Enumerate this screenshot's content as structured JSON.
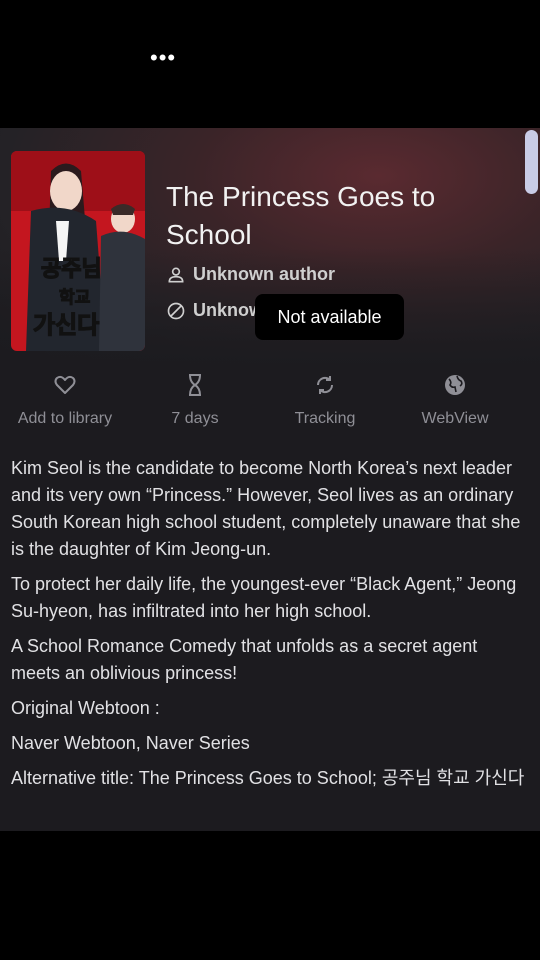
{
  "status_bar": {
    "overflow_icon": "more-dots-icon"
  },
  "manga": {
    "title": "The Princess Goes to School",
    "author": "Unknown author",
    "status": "Unknown",
    "cover_text": "공주님 학교 가신다"
  },
  "toast": {
    "text": "Not available"
  },
  "actions": [
    {
      "label": "Add to library",
      "icon": "heart-icon"
    },
    {
      "label": "7 days",
      "icon": "hourglass-icon"
    },
    {
      "label": "Tracking",
      "icon": "sync-icon"
    },
    {
      "label": "WebView",
      "icon": "globe-icon"
    }
  ],
  "description": [
    "Kim Seol is the candidate to become North Korea’s next leader and its very own “Princess.” However, Seol lives as an ordinary South Korean high school student, completely unaware that she is the daughter of Kim Jeong-un.",
    "To protect her daily life, the youngest-ever “Black Agent,” Jeong Su-hyeon, has infiltrated into her high school.",
    "A School Romance Comedy that unfolds as a secret agent meets an oblivious princess!",
    "Original Webtoon :",
    "Naver Webtoon, Naver Series",
    "Alternative title: The Princess Goes to School; 공주님 학교 가신다"
  ],
  "colors": {
    "background": "#1c1b1f",
    "accent": "#c9cce6",
    "muted": "#8f8f96"
  }
}
